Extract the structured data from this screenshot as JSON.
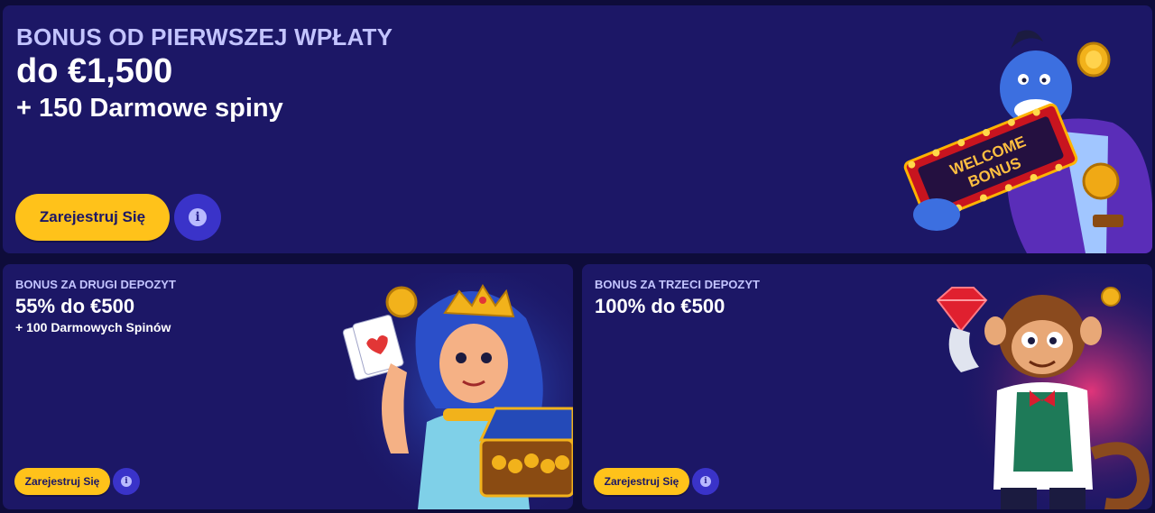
{
  "main": {
    "eyebrow": "BONUS OD PIERWSZEJ WPŁATY",
    "headline": "do €1,500",
    "sub": "+ 150 Darmowe spiny",
    "button_label": "Zarejestruj Się",
    "info_icon": "i",
    "sign_line1": "WELCOME",
    "sign_line2": "BONUS"
  },
  "second": {
    "eyebrow": "BONUS ZA DRUGI DEPOZYT",
    "headline": "55% do €500",
    "sub": "+ 100 Darmowych Spinów",
    "button_label": "Zarejestruj Się",
    "info_icon": "i"
  },
  "third": {
    "eyebrow": "BONUS ZA TRZECI DEPOZYT",
    "headline": "100% do €500",
    "button_label": "Zarejestruj Się",
    "info_icon": "i"
  },
  "colors": {
    "page_bg": "#0e0c3a",
    "card_bg": "#1c1766",
    "accent_yellow": "#ffc21a",
    "info_button": "#3a33c9",
    "eyebrow_text": "#c3c4ff"
  }
}
